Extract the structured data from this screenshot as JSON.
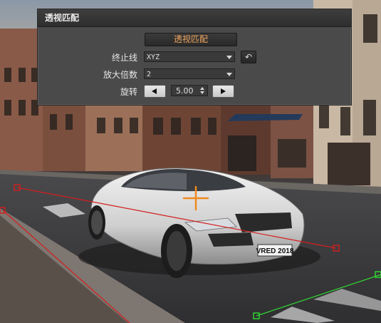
{
  "panel": {
    "title": "透视匹配",
    "match_button": "透视匹配",
    "vanishing_line": {
      "label": "终止线",
      "value": "XYZ"
    },
    "magnification": {
      "label": "放大倍数",
      "value": "2"
    },
    "rotation": {
      "label": "旋转",
      "value": "5.00"
    }
  },
  "scene": {
    "license_plate": "VRED 2018",
    "icons": {
      "reset": "undo-arrow-icon",
      "prev": "arrow-left-icon",
      "next": "arrow-right-icon"
    },
    "colors": {
      "red_line": "#d41e1e",
      "green_line": "#2fdc2f",
      "crosshair": "#f08a1e"
    }
  }
}
